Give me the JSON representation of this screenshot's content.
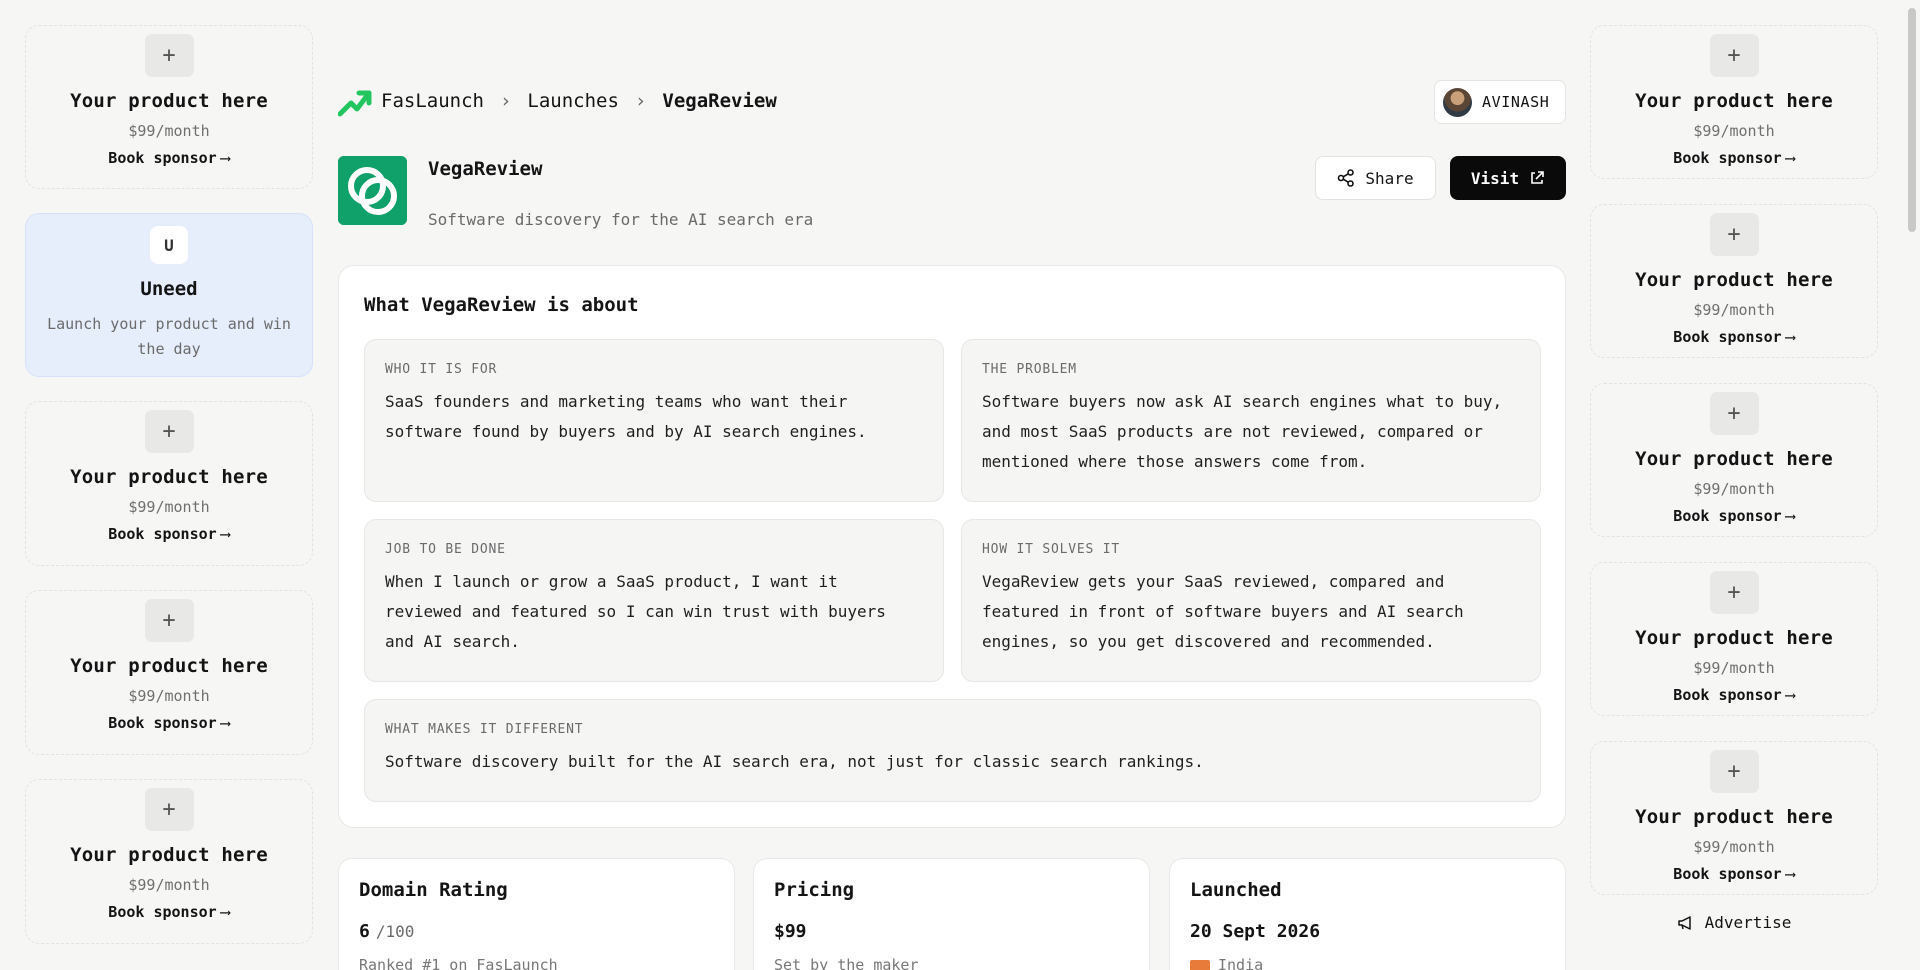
{
  "sponsor": {
    "title": "Your product here",
    "price": "$99/month",
    "book": "Book sponsor",
    "arrow": "⟶",
    "plus": "+"
  },
  "featured": {
    "logo_text": "U",
    "name": "Uneed",
    "desc": "Launch your product and win the day"
  },
  "breadcrumb": {
    "brand": "FasLaunch",
    "section": "Launches",
    "current": "VegaReview",
    "sep": "›"
  },
  "user": {
    "name": "AVINASH"
  },
  "product": {
    "name": "VegaReview",
    "tagline": "Software discovery for the AI search era",
    "share_label": "Share",
    "visit_label": "Visit"
  },
  "about": {
    "title": "What VegaReview is about",
    "who_label": "WHO IT IS FOR",
    "who_text": "SaaS founders and marketing teams who want their software found by buyers and by AI search engines.",
    "problem_label": "THE PROBLEM",
    "problem_text": "Software buyers now ask AI search engines what to buy, and most SaaS products are not reviewed, compared or mentioned where those answers come from.",
    "job_label": "JOB TO BE DONE",
    "job_text": "When I launch or grow a SaaS product, I want it reviewed and featured so I can win trust with buyers and AI search.",
    "solve_label": "HOW IT SOLVES IT",
    "solve_text": "VegaReview gets your SaaS reviewed, compared and featured in front of software buyers and AI search engines, so you get discovered and recommended.",
    "diff_label": "WHAT MAKES IT DIFFERENT",
    "diff_text": "Software discovery built for the AI search era, not just for classic search rankings."
  },
  "stats": {
    "domain_title": "Domain Rating",
    "domain_value": "6",
    "domain_max": "/100",
    "domain_note": "Ranked #1 on FasLaunch",
    "pricing_title": "Pricing",
    "pricing_value": "$99",
    "pricing_note": "Set by the maker",
    "launched_title": "Launched",
    "launched_value": "20 Sept 2026",
    "launched_note": "India"
  },
  "advertise_label": "Advertise",
  "colors": {
    "accent_green": "#10a06a",
    "featured_bg": "#e6edfb",
    "visit_bg": "#0a0a0a"
  }
}
